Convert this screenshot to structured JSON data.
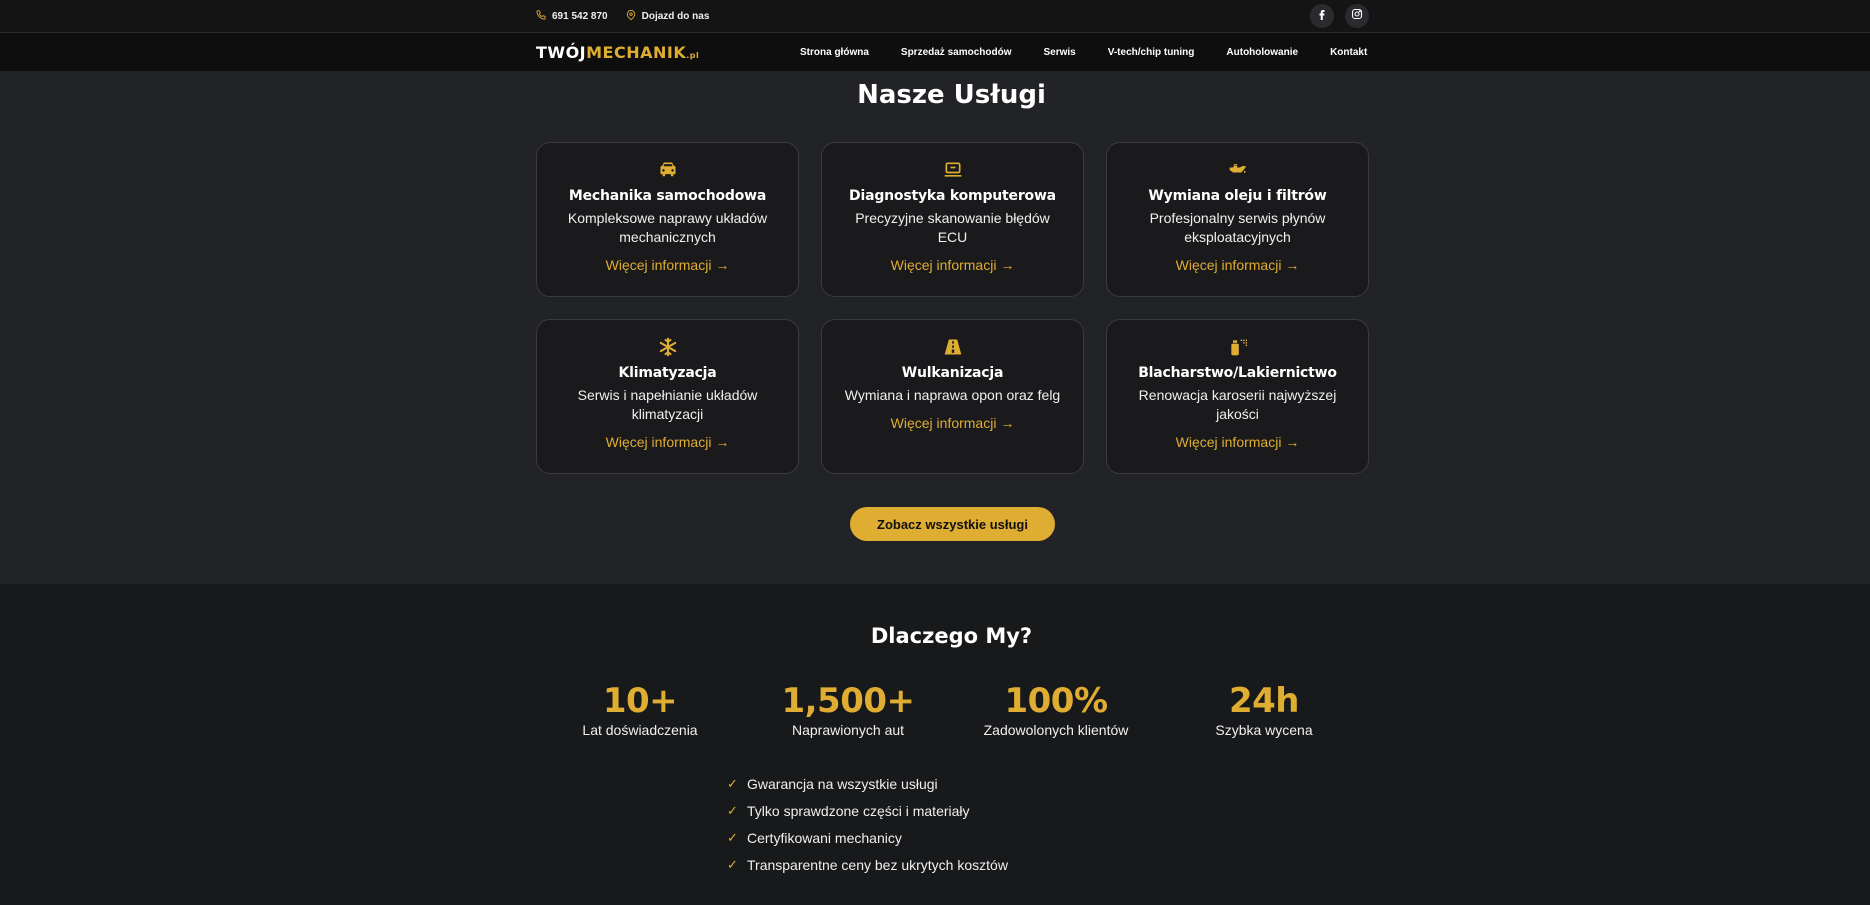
{
  "topbar": {
    "phone": "691 542 870",
    "directions": "Dojazd do nas"
  },
  "brand": {
    "part1": "TWÓJ",
    "part2": "MECHANIK",
    "tld": ".pl"
  },
  "nav": [
    "Strona główna",
    "Sprzedaż samochodów",
    "Serwis",
    "V-tech/chip tuning",
    "Autoholowanie",
    "Kontakt"
  ],
  "services": {
    "title": "Nasze Usługi",
    "more_label": "Więcej informacji →",
    "items": [
      {
        "icon": "car-icon",
        "title": "Mechanika samochodowa",
        "desc": "Kompleksowe naprawy układów mechanicznych"
      },
      {
        "icon": "laptop-icon",
        "title": "Diagnostyka komputerowa",
        "desc": "Precyzyjne skanowanie błędów ECU"
      },
      {
        "icon": "oil-can-icon",
        "title": "Wymiana oleju i filtrów",
        "desc": "Profesjonalny serwis płynów eksploatacyjnych"
      },
      {
        "icon": "snowflake-icon",
        "title": "Klimatyzacja",
        "desc": "Serwis i napełnianie układów klimatyzacji"
      },
      {
        "icon": "road-icon",
        "title": "Wulkanizacja",
        "desc": "Wymiana i naprawa opon oraz felg"
      },
      {
        "icon": "spray-can-icon",
        "title": "Blacharstwo/Lakiernictwo",
        "desc": "Renowacja karoserii najwyższej jakości"
      }
    ],
    "cta": "Zobacz wszystkie usługi"
  },
  "why": {
    "title": "Dlaczego My?",
    "stats": [
      {
        "value": "10+",
        "label": "Lat doświadczenia"
      },
      {
        "value": "1,500+",
        "label": "Naprawionych aut"
      },
      {
        "value": "100%",
        "label": "Zadowolonych klientów"
      },
      {
        "value": "24h",
        "label": "Szybka wycena"
      }
    ],
    "checklist": [
      "Gwarancja na wszystkie usługi",
      "Tylko sprawdzone części i materiały",
      "Certyfikowani mechanicy",
      "Transparentne ceny bez ukrytych kosztów"
    ]
  },
  "colors": {
    "accent": "#dfad32",
    "background": "#222326",
    "card": "#1a1a1c"
  }
}
